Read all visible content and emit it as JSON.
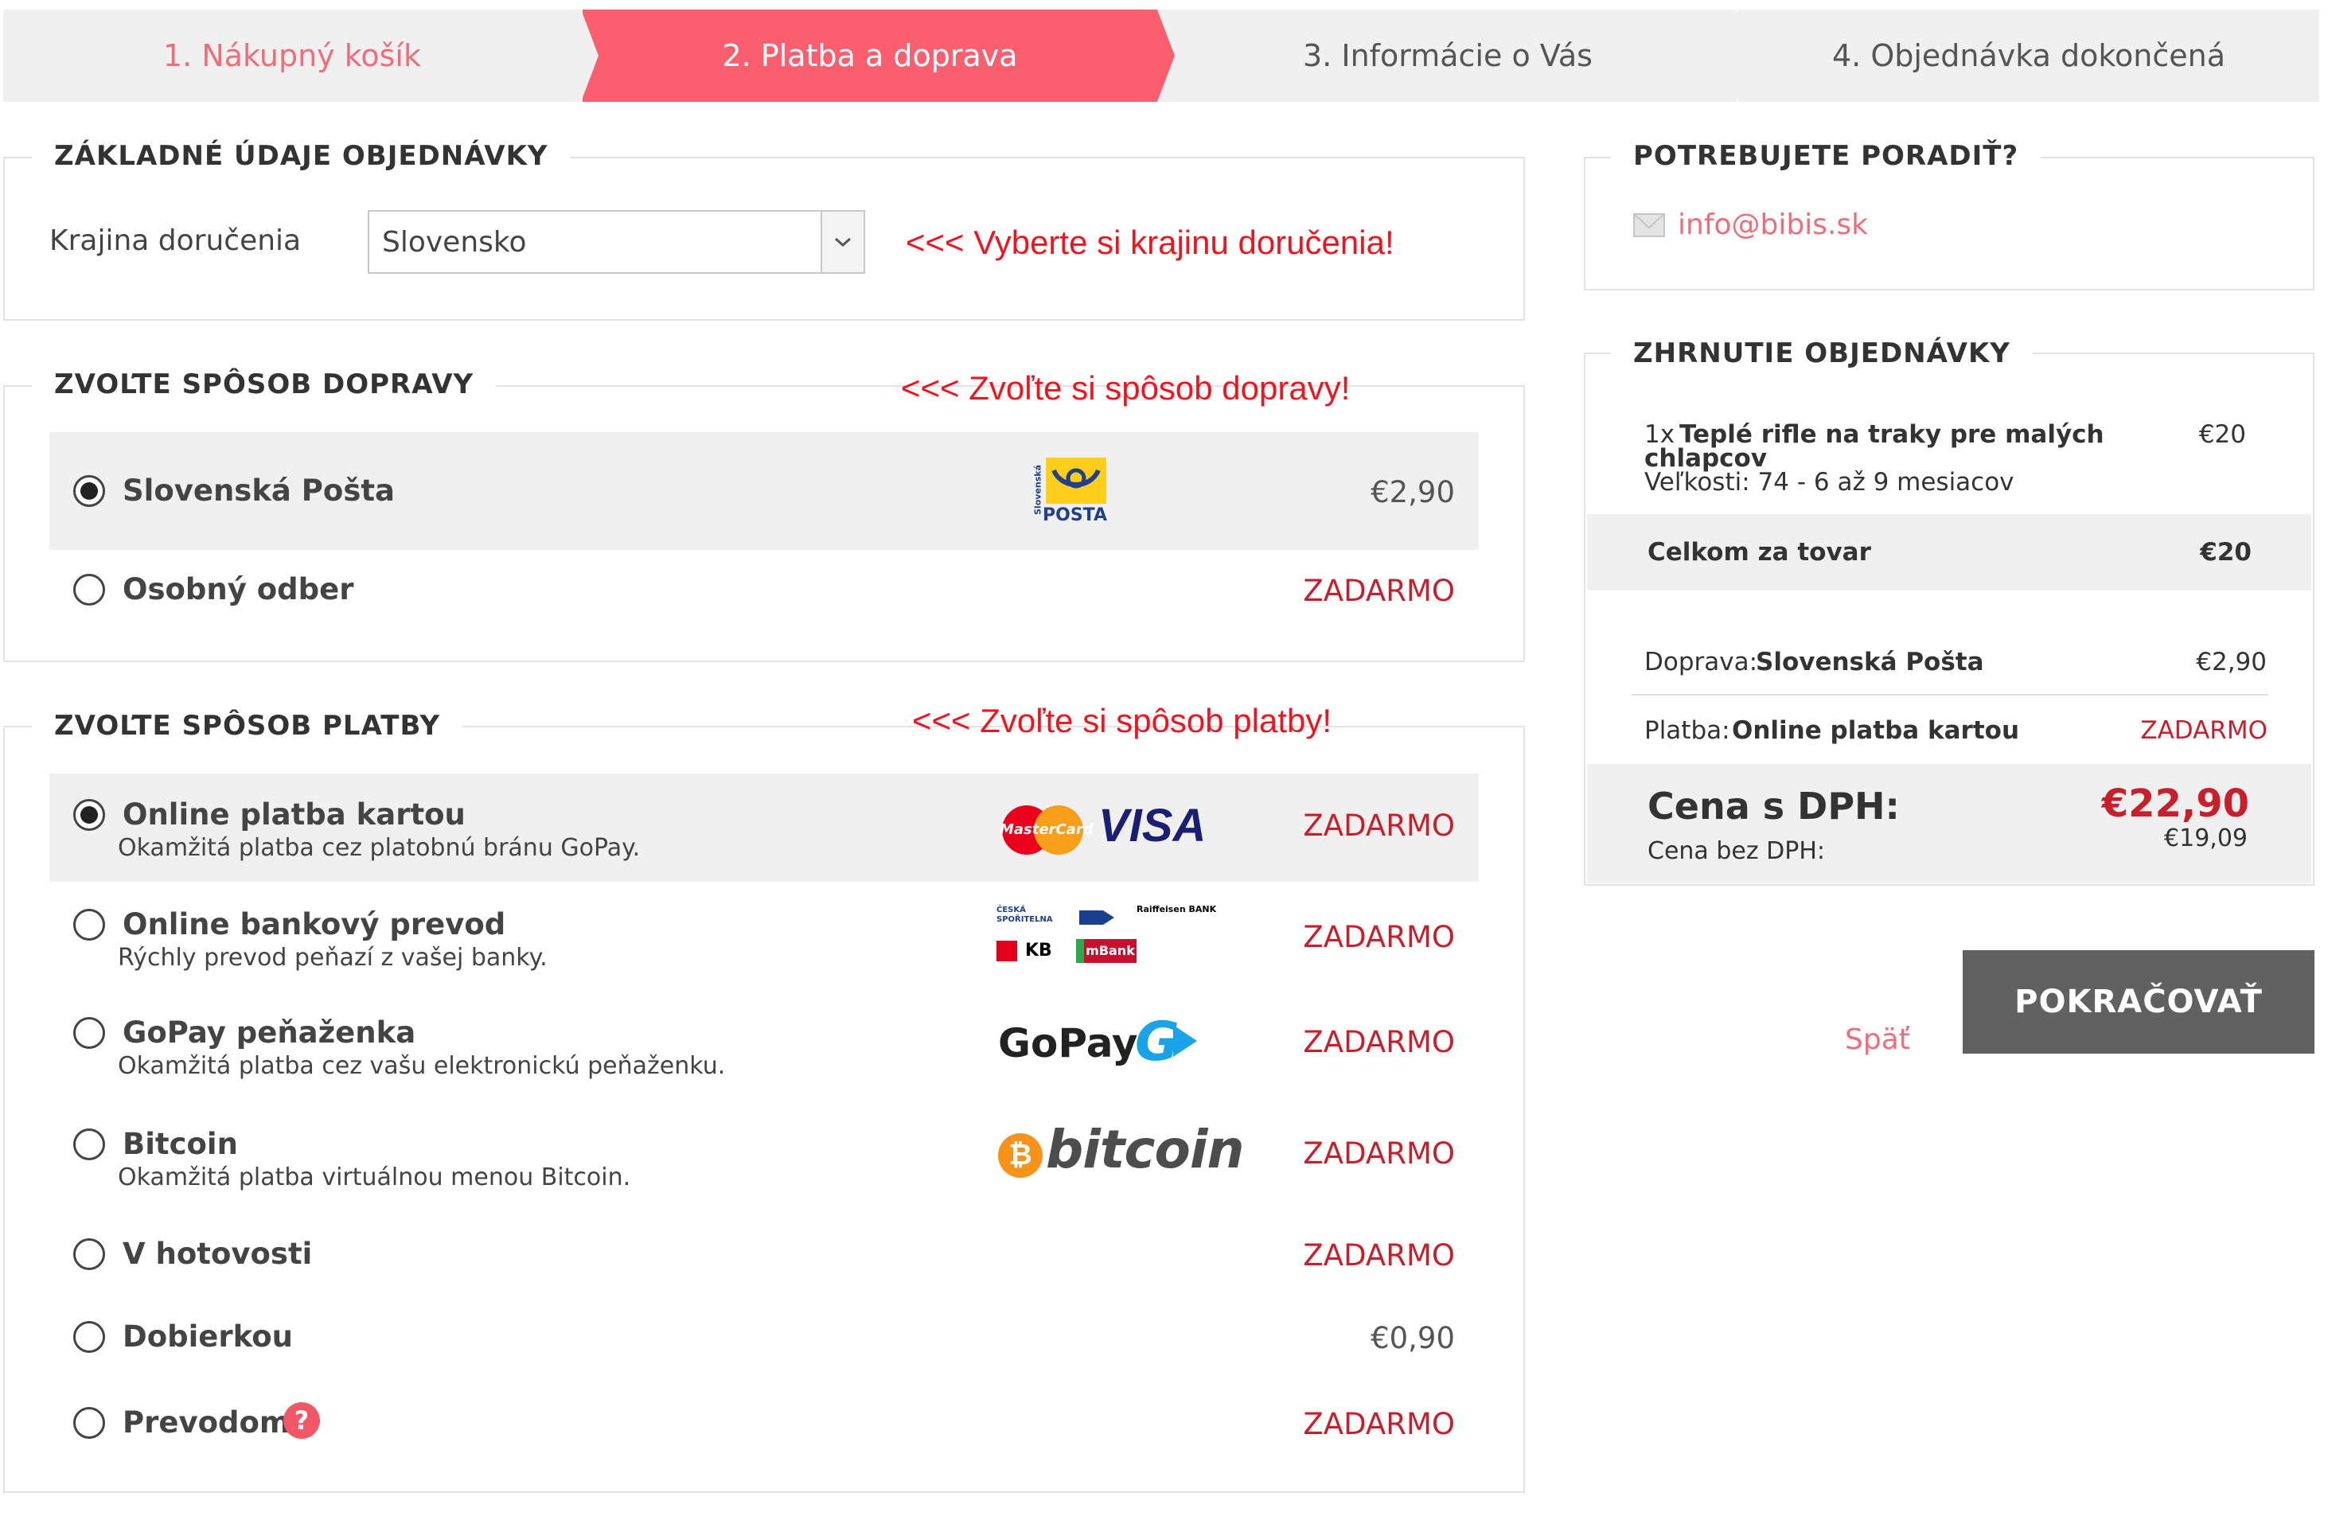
{
  "steps": [
    {
      "label": "1. Nákupný košík"
    },
    {
      "label": "2. Platba a doprava"
    },
    {
      "label": "3. Informácie o Vás"
    },
    {
      "label": "4. Objednávka dokončená"
    }
  ],
  "basic": {
    "title": "ZÁKLADNÉ ÚDAJE OBJEDNÁVKY",
    "country_label": "Krajina doručenia",
    "country_value": "Slovensko",
    "hint": "<<< Vyberte si krajinu doručenia!"
  },
  "shipping": {
    "title": "ZVOĽTE SPÔSOB DOPRAVY",
    "hint": "<<< Zvoľte si spôsob dopravy!",
    "options": [
      {
        "name": "Slovenská Pošta",
        "price": "€2,90",
        "logo_text": "POSTA",
        "logo_side": "Slovenská"
      },
      {
        "name": "Osobný odber",
        "price": "ZADARMO"
      }
    ]
  },
  "payment": {
    "title": "ZVOĽTE SPÔSOB PLATBY",
    "hint": "<<< Zvoľte si spôsob platby!",
    "options": [
      {
        "name": "Online platba kartou",
        "desc": "Okamžitá platba cez platobnú bránu GoPay.",
        "price": "ZADARMO",
        "logo1": "MasterCard",
        "logo2": "VISA"
      },
      {
        "name": "Online bankový prevod",
        "desc": "Rýchly prevod peňazí z vašej banky.",
        "price": "ZADARMO",
        "bank1": "ČESKÁ SPOŘITELNA",
        "bank2": "Raiffeisen BANK",
        "bank3": "KB",
        "bank4": "mBank"
      },
      {
        "name": "GoPay peňaženka",
        "desc": "Okamžitá platba cez vašu elektronickú peňaženku.",
        "price": "ZADARMO",
        "logo": "GoPay",
        "logo_g": "G"
      },
      {
        "name": "Bitcoin",
        "desc": "Okamžitá platba virtuálnou menou Bitcoin.",
        "price": "ZADARMO",
        "logo": "bitcoin",
        "logo_b": "₿"
      },
      {
        "name": "V hotovosti",
        "price": "ZADARMO"
      },
      {
        "name": "Dobierkou",
        "price": "€0,90"
      },
      {
        "name": "Prevodom",
        "price": "ZADARMO",
        "help": "?"
      }
    ]
  },
  "help": {
    "title": "POTREBUJETE PORADIŤ?",
    "email": "info@bibis.sk"
  },
  "summary": {
    "title": "ZHRNUTIE OBJEDNÁVKY",
    "item_qty": "1x",
    "item_name_1": "Teplé rifle na traky pre malých",
    "item_name_2": "chlapcov",
    "item_size": "Veľkosti: 74 - 6 až 9 mesiacov",
    "item_price": "€20",
    "goods_label": "Celkom za tovar",
    "goods_price": "€20",
    "shipping_label": "Doprava:",
    "shipping_name": "Slovenská Pošta",
    "shipping_price": "€2,90",
    "payment_label": "Platba:",
    "payment_name": "Online platba kartou",
    "payment_price": "ZADARMO",
    "total_label": "Cena s DPH:",
    "total_price": "€22,90",
    "net_label": "Cena bez DPH:",
    "net_price": "€19,09"
  },
  "actions": {
    "back": "Späť",
    "continue": "POKRAČOVAŤ"
  }
}
